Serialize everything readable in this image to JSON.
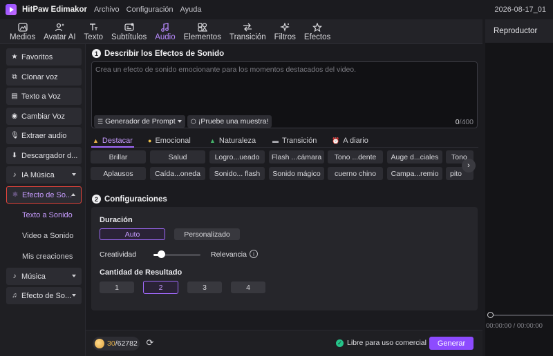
{
  "app": {
    "name": "HitPaw Edimakor",
    "menu": [
      "Archivo",
      "Configuración",
      "Ayuda"
    ],
    "datetime": "2026-08-17_01"
  },
  "tabs": [
    {
      "label": "Medios",
      "icon": "media-icon"
    },
    {
      "label": "Avatar AI",
      "icon": "avatar-icon"
    },
    {
      "label": "Texto",
      "icon": "text-icon"
    },
    {
      "label": "Subtítulos",
      "icon": "subtitles-icon"
    },
    {
      "label": "Audio",
      "icon": "audio-icon",
      "active": true
    },
    {
      "label": "Elementos",
      "icon": "elements-icon"
    },
    {
      "label": "Transición",
      "icon": "transition-icon"
    },
    {
      "label": "Filtros",
      "icon": "filters-icon"
    },
    {
      "label": "Efectos",
      "icon": "effects-icon"
    }
  ],
  "player": {
    "title": "Reproductor",
    "time": "00:00:00 / 00:00:00"
  },
  "sidebar": {
    "items": [
      {
        "label": "Favoritos",
        "icon": "star-icon"
      },
      {
        "label": "Clonar voz",
        "icon": "clone-voice-icon"
      },
      {
        "label": "Texto a Voz",
        "icon": "text-to-voice-icon"
      },
      {
        "label": "Cambiar Voz",
        "icon": "change-voice-icon"
      },
      {
        "label": "Extraer audio",
        "icon": "microphone-icon"
      },
      {
        "label": "Descargador d...",
        "icon": "download-icon"
      },
      {
        "label": "IA Música",
        "icon": "ai-music-icon"
      },
      {
        "label": "Efecto de So...",
        "icon": "sound-effect-icon"
      }
    ],
    "sub_items": [
      "Texto a Sonido",
      "Video a Sonido",
      "Mis creaciones"
    ],
    "bottom_items": [
      {
        "label": "Música",
        "icon": "music-note-icon"
      },
      {
        "label": "Efecto de So...",
        "icon": "music-notes-icon"
      }
    ]
  },
  "describe": {
    "num": "1",
    "title": "Describir los Efectos de Sonido",
    "placeholder": "Crea un efecto de sonido emocionante para los momentos destacados del video.",
    "prompt_generator": "Generador de Prompt",
    "try_sample": "¡Pruebe una muestra!",
    "count": "0",
    "max": "/400"
  },
  "categories": [
    {
      "label": "Destacar",
      "icon": "highlight-icon",
      "color": "#e8b24a"
    },
    {
      "label": "Emocional",
      "icon": "emotional-icon",
      "color": "#f0c34a"
    },
    {
      "label": "Naturaleza",
      "icon": "nature-icon",
      "color": "#46b36b"
    },
    {
      "label": "Transición",
      "icon": "transition-cat-icon",
      "color": "#b0b0b6"
    },
    {
      "label": "A diario",
      "icon": "daily-icon",
      "color": "#e8453c"
    }
  ],
  "chips_row1": [
    "Brillar",
    "Salud",
    "Logro...ueado",
    "Flash ...cámara",
    "Tono ...dente",
    "Auge d...ciales",
    "Tono"
  ],
  "chips_row2": [
    "Aplausos",
    "Caída...oneda",
    "Sonido... flash",
    "Sonido mágico",
    "cuerno chino",
    "Campa...remio",
    "pito"
  ],
  "config": {
    "num": "2",
    "title": "Configuraciones",
    "duration_label": "Duración",
    "auto": "Auto",
    "custom": "Personalizado",
    "creativity": "Creatividad",
    "relevance": "Relevancia",
    "result_label": "Cantidad de Resultado",
    "counts": [
      "1",
      "2",
      "3",
      "4"
    ],
    "selected_count": "2"
  },
  "bottom": {
    "credits_used": "30",
    "credits_total": "/62782",
    "free_commercial": "Libre para uso comercial",
    "generate": "Generar"
  },
  "colors": {
    "accent": "#a36bff",
    "generate_button": "#8d4bff",
    "selected_outline": "#e8453c"
  }
}
